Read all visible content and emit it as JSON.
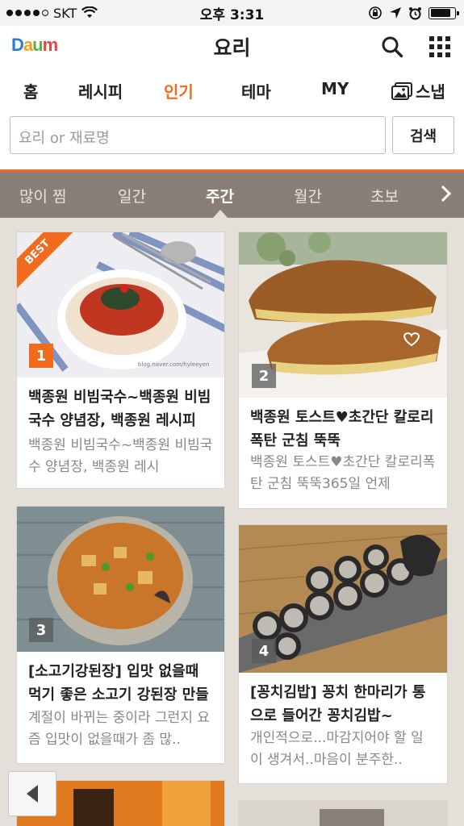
{
  "status": {
    "carrier": "SKT",
    "time": "오후 3:31",
    "battery_level": 0.85
  },
  "header": {
    "logo": {
      "d": "D",
      "a": "a",
      "u": "u",
      "m": "m"
    },
    "title": "요리",
    "icons": [
      "search-icon",
      "grid-menu-icon"
    ]
  },
  "nav": {
    "tabs": [
      "홈",
      "레시피",
      "인기",
      "테마",
      "MY",
      "스냅"
    ],
    "active": "인기",
    "accent": "#f26b1d"
  },
  "search": {
    "placeholder": "요리 or 재료명",
    "button": "검색"
  },
  "subnav": {
    "tabs": [
      "많이 찜",
      "일간",
      "주간",
      "월간",
      "초보"
    ],
    "active": "주간",
    "bg": "#8a7f77"
  },
  "cards": [
    {
      "rank": "1",
      "badge": "BEST",
      "title": "백종원 비빔국수~백종원 비빔국수 양념장, 백종원 레시피",
      "desc": "백종원 비빔국수~백종원 비빔국수 양념장, 백종원 레시",
      "watermark": "blog.naver.com/hyleeyen"
    },
    {
      "rank": "2",
      "title": "백종원 토스트♥초간단 칼로리폭탄 군침 뚝뚝",
      "desc": "백종원 토스트♥초간단 칼로리폭탄 군침 뚝뚝365일 언제"
    },
    {
      "rank": "3",
      "title": "[소고기강된장] 입맛 없을때 먹기 좋은 소고기 강된장 만들",
      "desc": "계절이 바뀌는 중이라 그런지 요즘 입맛이 없을때가 좀 많.."
    },
    {
      "rank": "4",
      "title": "[꽁치김밥] 꽁치 한마리가 통으로 들어간 꽁치김밥~",
      "desc": "개인적으로...마감지어야 할 일이 생겨서..마음이 분주한.."
    }
  ]
}
